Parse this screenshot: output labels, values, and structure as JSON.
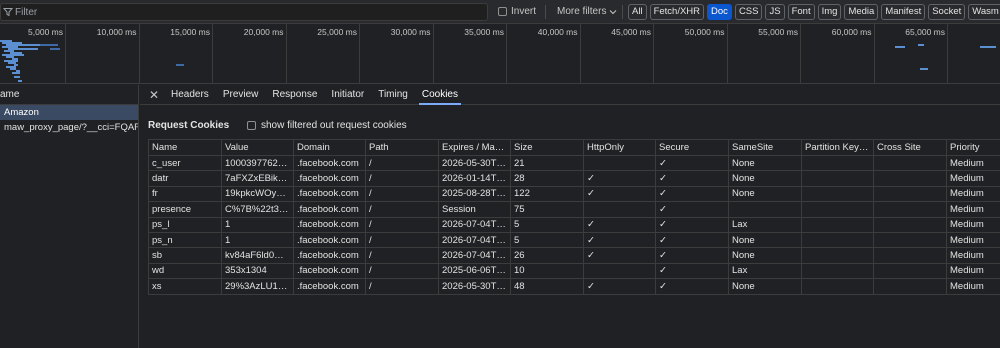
{
  "filter": {
    "placeholder": "Filter"
  },
  "invert_label": "Invert",
  "more_filters_label": "More filters",
  "type_filters": [
    "All",
    "Fetch/XHR",
    "Doc",
    "CSS",
    "JS",
    "Font",
    "Img",
    "Media",
    "Manifest",
    "Socket",
    "Wasm"
  ],
  "active_type_filter": "Doc",
  "timeline_ticks": [
    "5,000 ms",
    "10,000 ms",
    "15,000 ms",
    "20,000 ms",
    "25,000 ms",
    "30,000 ms",
    "35,000 ms",
    "40,000 ms",
    "45,000 ms",
    "50,000 ms",
    "55,000 ms",
    "60,000 ms",
    "65,000 ms",
    "70"
  ],
  "name_column_header": "ame",
  "requests": [
    {
      "label": "Amazon",
      "selected": true
    },
    {
      "label": "maw_proxy_page/?__cci=FQAR...",
      "selected": false
    }
  ],
  "detail_tabs": [
    "Headers",
    "Preview",
    "Response",
    "Initiator",
    "Timing",
    "Cookies"
  ],
  "active_detail_tab": "Cookies",
  "request_cookies_title": "Request Cookies",
  "show_filtered_label": "show filtered out request cookies",
  "columns": [
    "Name",
    "Value",
    "Domain",
    "Path",
    "Expires / Max-...",
    "Size",
    "HttpOnly",
    "Secure",
    "SameSite",
    "Partition Key S...",
    "Cross Site",
    "Priority"
  ],
  "cookies": [
    {
      "name": "c_user",
      "value": "10003977622...",
      "domain": ".facebook.com",
      "path": "/",
      "expires": "2026-05-30T0...",
      "size": "21",
      "httponly": "",
      "secure": "✓",
      "samesite": "None",
      "partition_key": "",
      "cross_site": "",
      "priority": "Medium"
    },
    {
      "name": "datr",
      "value": "7aFXZxEBik6z...",
      "domain": ".facebook.com",
      "path": "/",
      "expires": "2026-01-14T0...",
      "size": "28",
      "httponly": "✓",
      "secure": "✓",
      "samesite": "None",
      "partition_key": "",
      "cross_site": "",
      "priority": "Medium"
    },
    {
      "name": "fr",
      "value": "19kpkcWOy6L...",
      "domain": ".facebook.com",
      "path": "/",
      "expires": "2025-08-28T0...",
      "size": "122",
      "httponly": "✓",
      "secure": "✓",
      "samesite": "None",
      "partition_key": "",
      "cross_site": "",
      "priority": "Medium"
    },
    {
      "name": "presence",
      "value": "C%7B%22t3%...",
      "domain": ".facebook.com",
      "path": "/",
      "expires": "Session",
      "size": "75",
      "httponly": "",
      "secure": "✓",
      "samesite": "",
      "partition_key": "",
      "cross_site": "",
      "priority": "Medium"
    },
    {
      "name": "ps_l",
      "value": "1",
      "domain": ".facebook.com",
      "path": "/",
      "expires": "2026-07-04T0...",
      "size": "5",
      "httponly": "✓",
      "secure": "✓",
      "samesite": "Lax",
      "partition_key": "",
      "cross_site": "",
      "priority": "Medium"
    },
    {
      "name": "ps_n",
      "value": "1",
      "domain": ".facebook.com",
      "path": "/",
      "expires": "2026-07-04T0...",
      "size": "5",
      "httponly": "✓",
      "secure": "✓",
      "samesite": "None",
      "partition_key": "",
      "cross_site": "",
      "priority": "Medium"
    },
    {
      "name": "sb",
      "value": "kv84aF6ld0Ma...",
      "domain": ".facebook.com",
      "path": "/",
      "expires": "2026-07-04T0...",
      "size": "26",
      "httponly": "✓",
      "secure": "✓",
      "samesite": "None",
      "partition_key": "",
      "cross_site": "",
      "priority": "Medium"
    },
    {
      "name": "wd",
      "value": "353x1304",
      "domain": ".facebook.com",
      "path": "/",
      "expires": "2025-06-06T0...",
      "size": "10",
      "httponly": "",
      "secure": "✓",
      "samesite": "Lax",
      "partition_key": "",
      "cross_site": "",
      "priority": "Medium"
    },
    {
      "name": "xs",
      "value": "29%3AzLU1Be...",
      "domain": ".facebook.com",
      "path": "/",
      "expires": "2026-05-30T0...",
      "size": "48",
      "httponly": "✓",
      "secure": "✓",
      "samesite": "None",
      "partition_key": "",
      "cross_site": "",
      "priority": "Medium"
    }
  ],
  "colors": {
    "accent": "#0b57d0",
    "tab_underline": "#7cacf8",
    "selected_row": "#3a4a63",
    "waterfall_bar": "#5b8fd1"
  }
}
